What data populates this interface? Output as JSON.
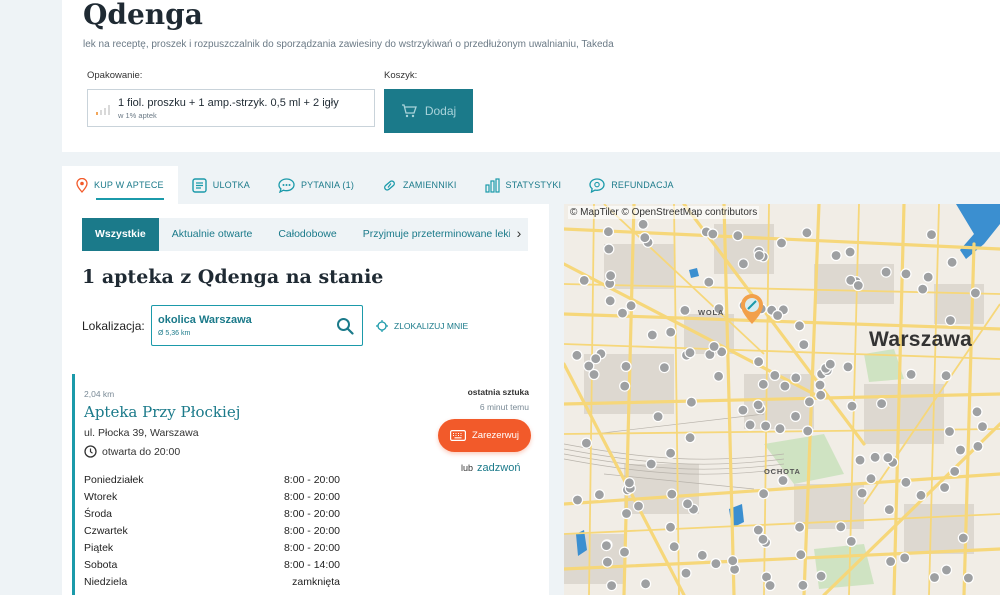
{
  "product": {
    "title": "Qdenga",
    "subtitle": "lek na receptę, proszek i rozpuszczalnik do sporządzania zawiesiny do wstrzykiwań o przedłużonym uwalnianiu, Takeda",
    "packaging_label": "Opakowanie:",
    "packaging_value": "1 fiol. proszku + 1 amp.-strzyk. 0,5 ml + 2 igły",
    "packaging_availability": "w 1% aptek",
    "cart_label": "Koszyk:",
    "add_button": "Dodaj"
  },
  "tabs": [
    {
      "label": "KUP W APTECE",
      "icon": "pin-icon"
    },
    {
      "label": "ULOTKA",
      "icon": "leaflet-icon"
    },
    {
      "label": "PYTANIA (1)",
      "icon": "chat-icon"
    },
    {
      "label": "ZAMIENNIKI",
      "icon": "pill-icon"
    },
    {
      "label": "STATYSTYKI",
      "icon": "bar-chart-icon"
    },
    {
      "label": "REFUNDACJA",
      "icon": "refund-icon"
    }
  ],
  "filters": [
    "Wszystkie",
    "Aktualnie otwarte",
    "Całodobowe",
    "Przyjmuje przeterminowane leki"
  ],
  "results_heading": "1 apteka z Qdenga na stanie",
  "location": {
    "label": "Lokalizacja:",
    "value": "okolica Warszawa",
    "radius": "Ø 5,36 km",
    "locate_me": "ZLOKALIZUJ MNIE"
  },
  "pharmacy": {
    "distance": "2,04 km",
    "name": "Apteka Przy Płockiej",
    "address": "ul. Płocka 39, Warszawa",
    "open_status": "otwarta do 20:00",
    "stock_status": "ostatnia sztuka",
    "updated": "6 minut temu",
    "reserve_button": "Zarezerwuj",
    "or_label": "lub",
    "call_link": "zadzwoń",
    "hours": [
      {
        "day": "Poniedziałek",
        "time": "8:00 - 20:00"
      },
      {
        "day": "Wtorek",
        "time": "8:00 - 20:00"
      },
      {
        "day": "Środa",
        "time": "8:00 - 20:00"
      },
      {
        "day": "Czwartek",
        "time": "8:00 - 20:00"
      },
      {
        "day": "Piątek",
        "time": "8:00 - 20:00"
      },
      {
        "day": "Sobota",
        "time": "8:00 - 14:00"
      },
      {
        "day": "Niedziela",
        "time": "zamknięta"
      }
    ]
  },
  "map": {
    "attribution": "© MapTiler © OpenStreetMap contributors",
    "city_label": "Warszawa",
    "districts": [
      "WOLA",
      "OCHOTA"
    ]
  },
  "colors": {
    "primary": "#1b7a8a",
    "accent": "#f25a2a",
    "road": "#f6d77a",
    "water": "#3b8fd0"
  }
}
